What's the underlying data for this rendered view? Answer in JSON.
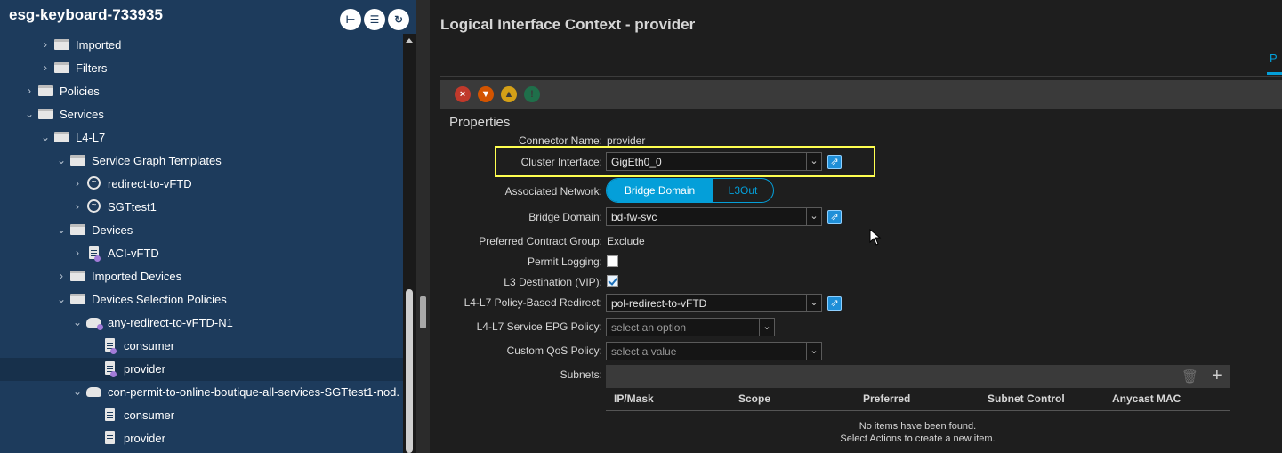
{
  "nav": {
    "title": "esg-keyboard-733935",
    "tree": [
      {
        "label": "Imported",
        "icon": "folder-icon"
      },
      {
        "label": "Filters",
        "icon": "folder-icon"
      },
      {
        "label": "Policies",
        "icon": "folder-icon"
      },
      {
        "label": "Services",
        "icon": "folder-icon"
      },
      {
        "label": "L4-L7",
        "icon": "folder-icon"
      },
      {
        "label": "Service Graph Templates",
        "icon": "folder-icon"
      },
      {
        "label": "redirect-to-vFTD",
        "icon": "service-graph-icon"
      },
      {
        "label": "SGTtest1",
        "icon": "service-graph-icon"
      },
      {
        "label": "Devices",
        "icon": "folder-icon"
      },
      {
        "label": "ACI-vFTD",
        "icon": "device-icon"
      },
      {
        "label": "Imported Devices",
        "icon": "folder-icon"
      },
      {
        "label": "Devices Selection Policies",
        "icon": "folder-icon"
      },
      {
        "label": "any-redirect-to-vFTD-N1",
        "icon": "cloud-icon"
      },
      {
        "label": "consumer",
        "icon": "document-icon"
      },
      {
        "label": "provider",
        "icon": "document-icon",
        "selected": true
      },
      {
        "label": "con-permit-to-online-boutique-all-services-SGTtest1-nod.",
        "icon": "cloud-icon"
      },
      {
        "label": "consumer",
        "icon": "document-icon"
      },
      {
        "label": "provider",
        "icon": "document-icon"
      }
    ]
  },
  "panel": {
    "title": "Logical Interface Context - provider",
    "tab_label": "P",
    "properties_heading": "Properties"
  },
  "form": {
    "connector_name_label": "Connector Name:",
    "connector_name_value": "provider",
    "cluster_interface_label": "Cluster Interface:",
    "cluster_interface_value": "GigEth0_0",
    "associated_network_label": "Associated Network:",
    "associated_network_options": [
      "Bridge Domain",
      "L3Out"
    ],
    "associated_network_selected": "Bridge Domain",
    "bridge_domain_label": "Bridge Domain:",
    "bridge_domain_value": "bd-fw-svc",
    "preferred_contract_group_label": "Preferred Contract Group:",
    "preferred_contract_group_value": "Exclude",
    "permit_logging_label": "Permit Logging:",
    "permit_logging_checked": false,
    "l3_destination_label": "L3 Destination (VIP):",
    "l3_destination_checked": true,
    "pbr_label": "L4-L7 Policy-Based Redirect:",
    "pbr_value": "pol-redirect-to-vFTD",
    "service_epg_label": "L4-L7 Service EPG Policy:",
    "service_epg_placeholder": "select an option",
    "custom_qos_label": "Custom QoS Policy:",
    "custom_qos_placeholder": "select a value",
    "subnets_label": "Subnets:"
  },
  "subnets_table": {
    "columns": [
      "IP/Mask",
      "Scope",
      "Preferred",
      "Subnet Control",
      "Anycast MAC"
    ],
    "empty_line1": "No items have been found.",
    "empty_line2": "Select Actions to create a new item."
  },
  "colors": {
    "accent": "#049fd9",
    "nav_background": "#1d3b5c",
    "highlight": "#ffff50"
  }
}
